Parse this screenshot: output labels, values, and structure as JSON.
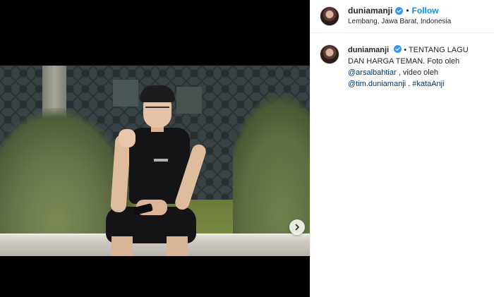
{
  "post": {
    "username": "duniamanji",
    "follow_label": "Follow",
    "separator": "•",
    "location": "Lembang, Jawa Barat, Indonesia"
  },
  "caption": {
    "username": "duniamanji",
    "text_part1": "• TENTANG LAGU DAN HARGA TEMAN. Foto oleh",
    "mention1": "@arsalbahtiar",
    "text_part2": ", video oleh",
    "mention2": "@tim.duniamanji",
    "text_part3": ".",
    "hashtag": "#kataAnji"
  },
  "media": {
    "next_icon": "chevron-right-icon"
  },
  "colors": {
    "accent": "#0095f6",
    "link": "#00376b",
    "verified": "#3897f0",
    "text": "#262626"
  }
}
